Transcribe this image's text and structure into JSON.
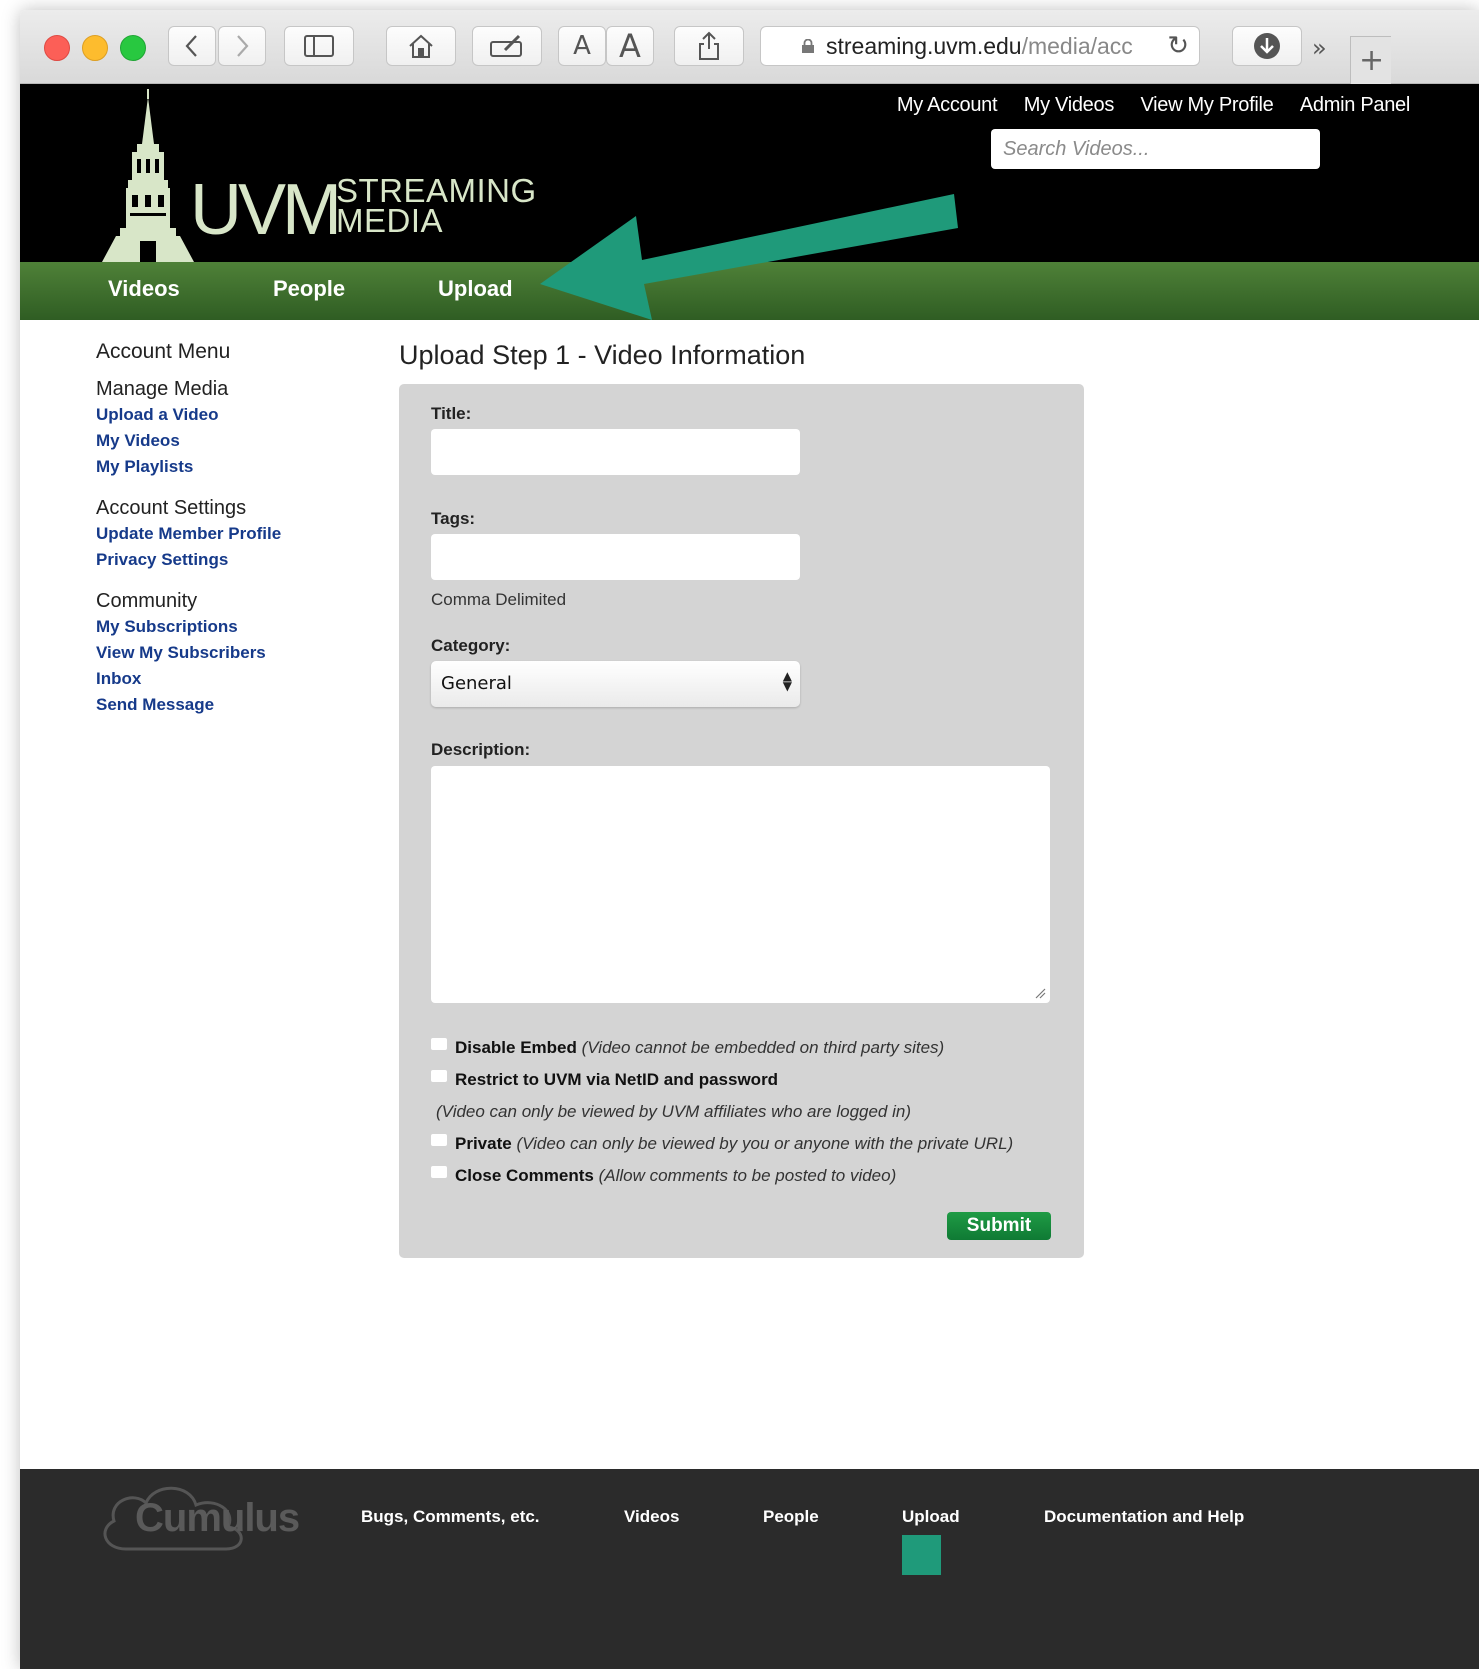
{
  "browser": {
    "url_host": "streaming.uvm.edu",
    "url_path": "/media/acc",
    "icons": [
      "back-icon",
      "forward-icon",
      "sidebar-icon",
      "home-icon",
      "annotate-icon",
      "text-smaller-icon",
      "text-larger-icon",
      "share-icon",
      "lock-icon",
      "reload-icon",
      "download-icon",
      "more-icon",
      "new-tab-icon"
    ],
    "font_small": "A",
    "font_large": "A"
  },
  "header": {
    "links": [
      "My Account",
      "My Videos",
      "View My Profile",
      "Admin Panel"
    ],
    "search_placeholder": "Search Videos...",
    "logo_uvm": "UVM",
    "logo_line1": "STREAMING",
    "logo_line2": "MEDIA"
  },
  "nav": {
    "items": [
      "Videos",
      "People",
      "Upload"
    ],
    "arrow_color": "#1f9a7a"
  },
  "sidebar": {
    "title": "Account Menu",
    "groups": [
      {
        "heading": "Manage Media",
        "links": [
          "Upload a Video",
          "My Videos",
          "My Playlists"
        ]
      },
      {
        "heading": "Account Settings",
        "links": [
          "Update Member Profile",
          "Privacy Settings"
        ]
      },
      {
        "heading": "Community",
        "links": [
          "My Subscriptions",
          "View My Subscribers",
          "Inbox",
          "Send Message"
        ]
      }
    ]
  },
  "form": {
    "page_title": "Upload Step 1 - Video Information",
    "title_label": "Title:",
    "title_value": "",
    "tags_label": "Tags:",
    "tags_value": "",
    "tags_hint": "Comma Delimited",
    "category_label": "Category:",
    "category_value": "General",
    "description_label": "Description:",
    "options": {
      "disable_embed": {
        "label": "Disable Embed",
        "note": "(Video cannot be embedded on third party sites)"
      },
      "restrict": {
        "label": "Restrict to UVM via NetID and password",
        "note": "(Video can only be viewed by UVM affiliates who are logged in)"
      },
      "private": {
        "label": "Private",
        "note": "(Video can only be viewed by you or anyone with the private URL)"
      },
      "close_comments": {
        "label": "Close Comments",
        "note": "(Allow comments to be posted to video)"
      }
    },
    "submit_label": "Submit"
  },
  "footer": {
    "brand": "Cumulus",
    "links": [
      "Bugs, Comments, etc.",
      "Videos",
      "People",
      "Upload",
      "Documentation and Help"
    ]
  },
  "colors": {
    "nav_green": "#3d6e2d",
    "link_blue": "#163a8a",
    "submit_green": "#16893c",
    "footer_bg": "#2b2b2b"
  }
}
